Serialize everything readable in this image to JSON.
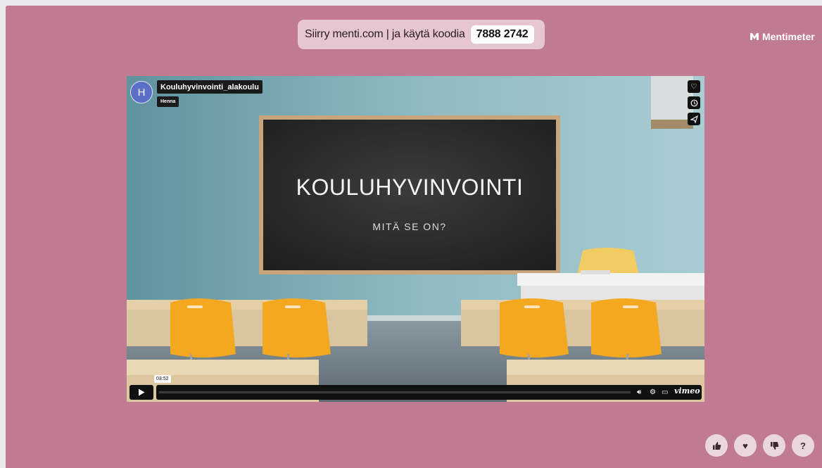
{
  "header": {
    "join_text": "Siirry menti.com | ja käytä koodia",
    "join_code": "7888 2742",
    "brand": "Mentimeter"
  },
  "video": {
    "avatar_letter": "H",
    "title": "Kouluhyvinvointi_alakoulu",
    "author": "Henna",
    "board_title": "KOULUHYVINVOINTI",
    "board_subtitle": "MITÄ SE ON?",
    "timestamp": "03:52",
    "player_brand": "vimeo",
    "side_buttons": [
      "heart-icon",
      "clock-icon",
      "share-icon"
    ]
  },
  "reactions": {
    "like": "thumbs-up-icon",
    "love": "heart-icon",
    "dislike": "thumbs-down-icon",
    "question": "?"
  },
  "colors": {
    "slide_background": "#c07a92",
    "pill_background": "#e6c6d1",
    "reaction_background": "#ead7de"
  }
}
